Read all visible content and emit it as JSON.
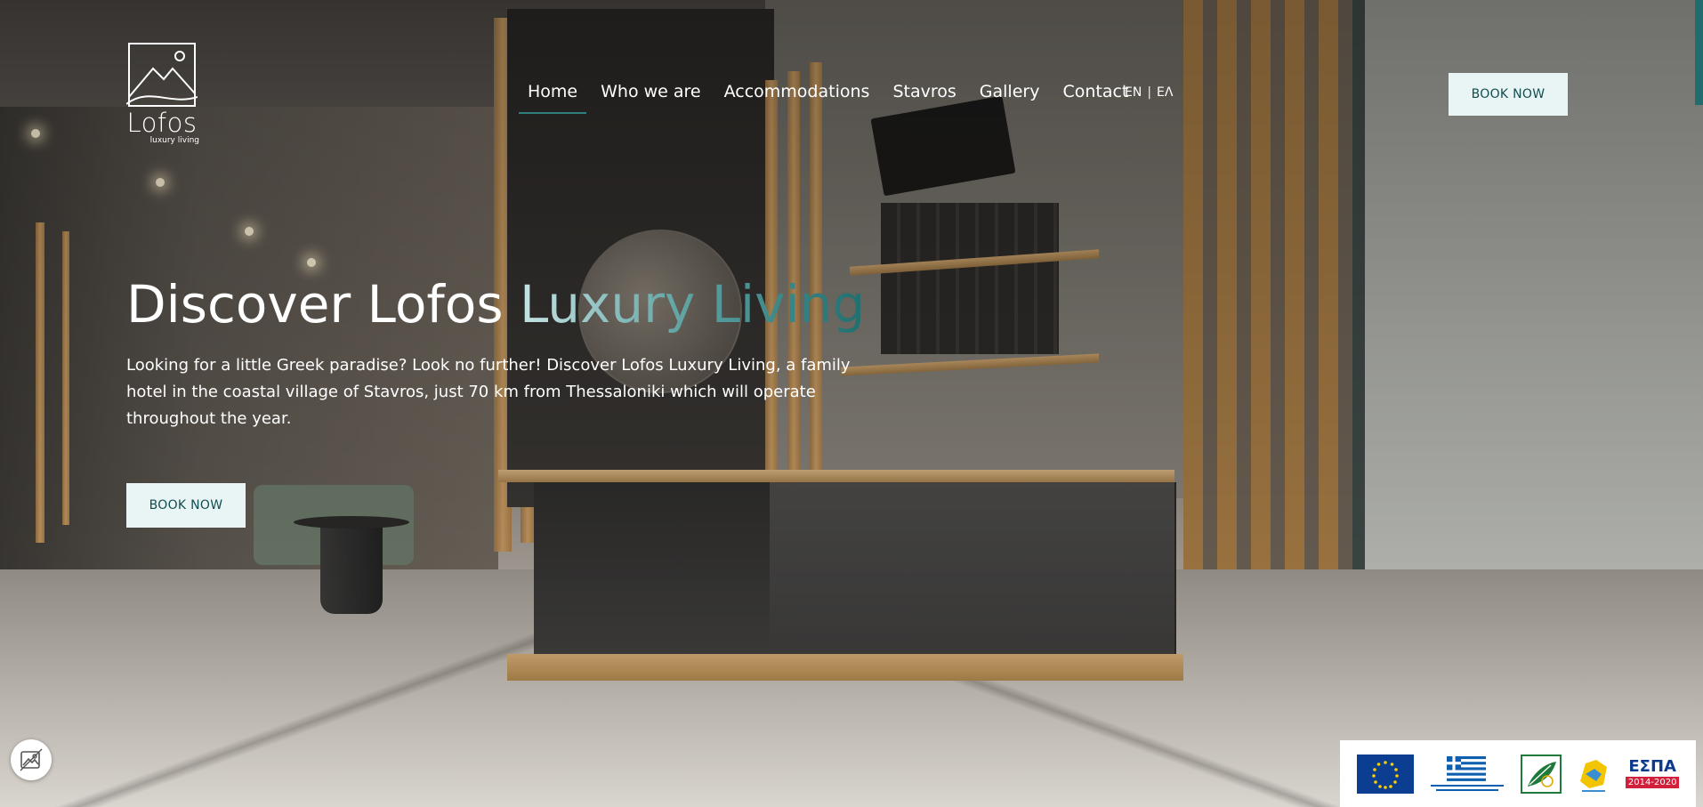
{
  "brand": {
    "name": "Lofos",
    "tagline": "luxury living"
  },
  "nav": {
    "items": [
      {
        "label": "Home",
        "active": true
      },
      {
        "label": "Who we are",
        "active": false
      },
      {
        "label": "Accommodations",
        "active": false
      },
      {
        "label": "Stavros",
        "active": false
      },
      {
        "label": "Gallery",
        "active": false
      },
      {
        "label": "Contact",
        "active": false
      }
    ],
    "accent_color": "#2f7f7d"
  },
  "language": {
    "current": "EN",
    "separator": "|",
    "other": "EΛ"
  },
  "header": {
    "book_label": "BOOK NOW"
  },
  "hero": {
    "title_main": "Discover Lofos ",
    "title_accent": "Luxury Living",
    "description": "Looking for a little Greek paradise? Look no further! Discover Lofos Luxury Living, a family hotel in the coastal village of Stavros, just 70 km from Thessaloniki which will operate throughout the year.",
    "book_label": "BOOK NOW"
  },
  "colors": {
    "button_bg": "#e9f5f4",
    "button_text": "#124c4f",
    "accent_teal": "#1f6f6f"
  },
  "accessibility": {
    "icon": "accessibility-image-icon"
  },
  "funding": {
    "logos": [
      "eu-flag-logo",
      "greek-flag-logo",
      "leader-logo",
      "region-logo",
      "espa-logo"
    ],
    "espa_text": "ΕΣΠΑ",
    "espa_years": "2014-2020"
  }
}
